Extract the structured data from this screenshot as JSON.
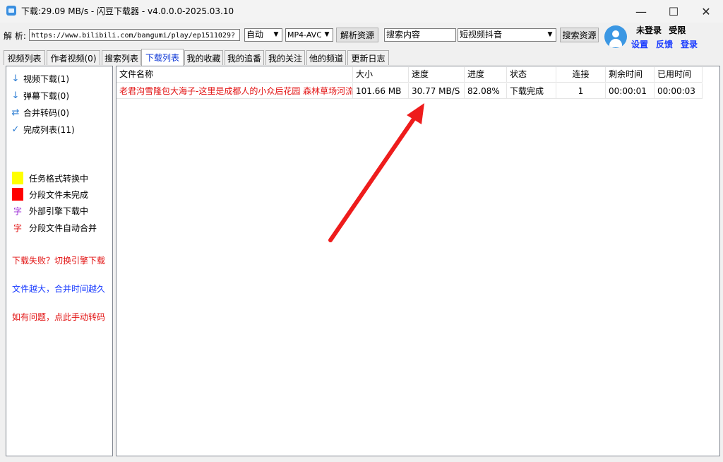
{
  "window": {
    "title": "下载:29.09 MB/s - 闪豆下载器 - v4.0.0.0-2025.03.10",
    "minimize_glyph": "—",
    "maximize_glyph": "☐",
    "close_glyph": "✕"
  },
  "toolbar": {
    "parse_label": "解 析:",
    "url_value": "https://www.bilibili.com/bangumi/play/ep1511029?",
    "quality_select": "自动",
    "format_select": "MP4-AVC",
    "parse_button": "解析资源",
    "search_value": "搜索内容",
    "platform_select": "短视频抖音",
    "search_button": "搜索资源"
  },
  "user": {
    "status": "未登录",
    "limit": "受限",
    "settings_link": "设置",
    "feedback_link": "反馈",
    "login_link": "登录"
  },
  "tabs": [
    {
      "label": "视频列表"
    },
    {
      "label": "作者视频(0)"
    },
    {
      "label": "搜索列表"
    },
    {
      "label": "下载列表"
    },
    {
      "label": "我的收藏"
    },
    {
      "label": "我的追番"
    },
    {
      "label": "我的关注"
    },
    {
      "label": "他的频道"
    },
    {
      "label": "更新日志"
    }
  ],
  "sidebar": {
    "items": [
      {
        "icon": "↓",
        "label": "视频下载(1)"
      },
      {
        "icon": "↓",
        "label": "弹幕下载(0)"
      },
      {
        "icon": "⇄",
        "label": "合并转码(0)"
      },
      {
        "icon": "✓",
        "label": "完成列表(11)"
      }
    ],
    "legend": [
      {
        "label": "任务格式转换中",
        "color": "#ffff00"
      },
      {
        "label": "分段文件未完成",
        "color": "#ff0000"
      },
      {
        "glyph": "字",
        "label": "外部引擎下载中",
        "glyph_color": "#9b2bd6"
      },
      {
        "glyph": "字",
        "label": "分段文件自动合并",
        "glyph_color": "#e21010"
      }
    ],
    "hints": [
      {
        "text": "下载失败？切换引擎下载",
        "color": "#e21010"
      },
      {
        "text": "文件越大，合并时间越久",
        "color": "#1a3cff"
      },
      {
        "text": "如有问题，点此手动转码",
        "color": "#e21010"
      }
    ]
  },
  "download_table": {
    "headers": {
      "name": "文件名称",
      "size": "大小",
      "speed": "速度",
      "progress": "进度",
      "status": "状态",
      "connections": "连接",
      "remaining": "剩余时间",
      "elapsed": "已用时间"
    },
    "rows": [
      {
        "name": "老君沟雪隆包大海子-这里是成都人的小众后花园 森林草场河流",
        "size": "101.66 MB",
        "speed": "30.77 MB/S",
        "progress": "82.08%",
        "status": "下载完成",
        "connections": "1",
        "remaining": "00:00:01",
        "elapsed": "00:00:03"
      }
    ]
  },
  "colors": {
    "accent_blue": "#1a3cff",
    "error_red": "#e21010",
    "annotation_arrow": "#ee1c1c"
  }
}
